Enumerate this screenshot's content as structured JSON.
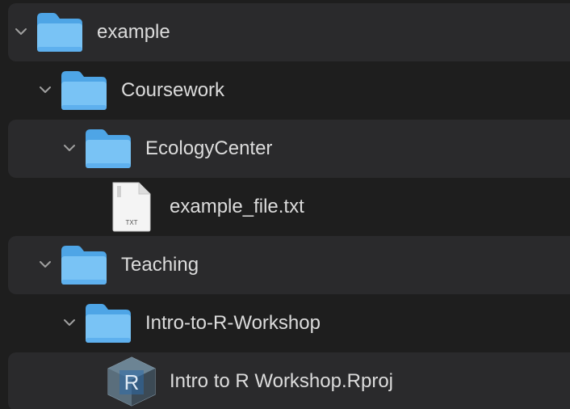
{
  "colors": {
    "window_bg": "#1e1e1e",
    "stripe_bg": "#2a2a2c",
    "text": "#dcdcdc",
    "chevron": "#a0a0a0",
    "folder_light": "#79c3f5",
    "folder_dark": "#4ea5e6"
  },
  "tree": {
    "items": [
      {
        "label": "example",
        "icon": "folder-icon",
        "expanded": true,
        "depth": 0
      },
      {
        "label": "Coursework",
        "icon": "folder-icon",
        "expanded": true,
        "depth": 1
      },
      {
        "label": "EcologyCenter",
        "icon": "folder-icon",
        "expanded": true,
        "depth": 2
      },
      {
        "label": "example_file.txt",
        "icon": "txt-file-icon",
        "icon_text": "TXT",
        "depth": 3
      },
      {
        "label": "Teaching",
        "icon": "folder-icon",
        "expanded": true,
        "depth": 1
      },
      {
        "label": "Intro-to-R-Workshop",
        "icon": "folder-icon",
        "expanded": true,
        "depth": 2
      },
      {
        "label": "Intro to R Workshop.Rproj",
        "icon": "rproj-file-icon",
        "icon_text": "R",
        "depth": 3
      }
    ]
  }
}
